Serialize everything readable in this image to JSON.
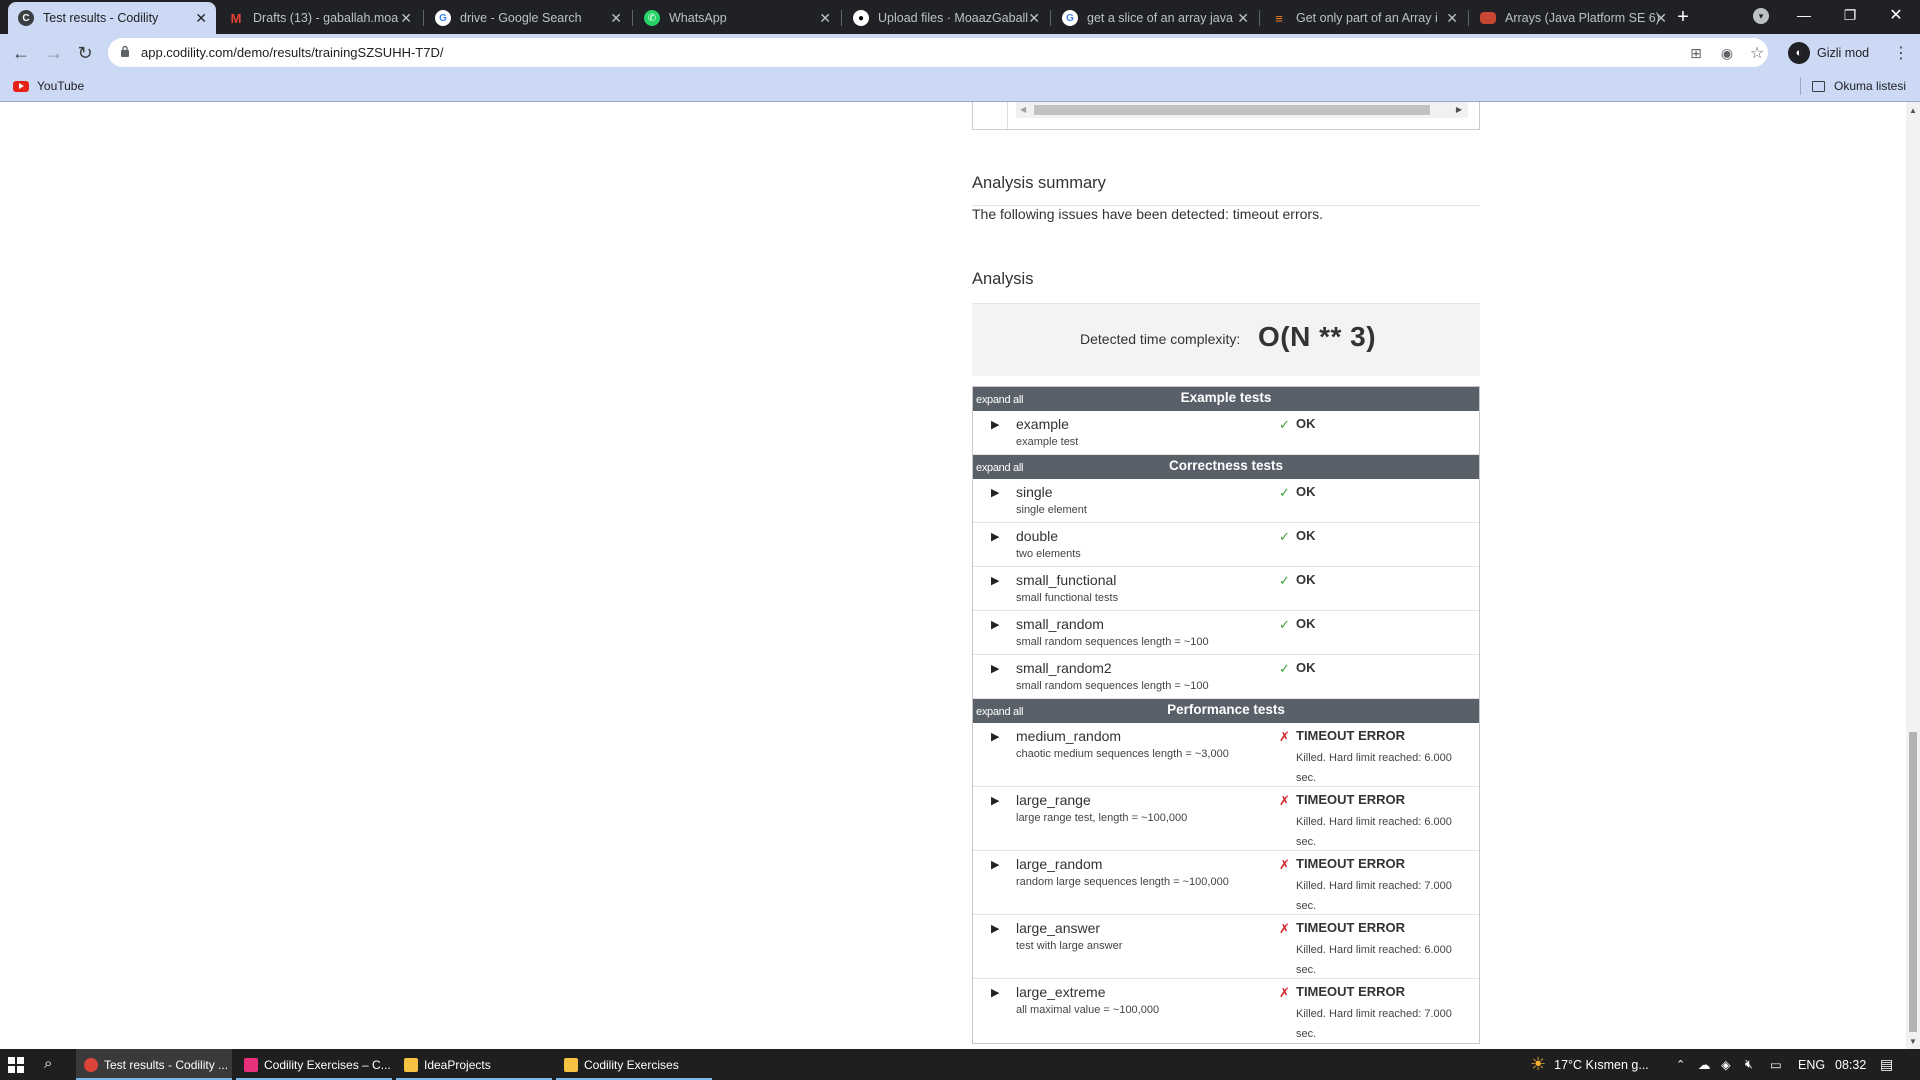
{
  "browser": {
    "tabs": [
      {
        "title": "Test results - Codility",
        "icon": "codility-icon",
        "active": true
      },
      {
        "title": "Drafts (13) - gaballah.moa",
        "icon": "gmail-icon"
      },
      {
        "title": "drive - Google Search",
        "icon": "google-icon"
      },
      {
        "title": "WhatsApp",
        "icon": "whatsapp-icon"
      },
      {
        "title": "Upload files · MoaazGaball",
        "icon": "github-icon"
      },
      {
        "title": "get a slice of an array java",
        "icon": "google-icon"
      },
      {
        "title": "Get only part of an Array i",
        "icon": "stackoverflow-icon"
      },
      {
        "title": "Arrays (Java Platform SE 6)",
        "icon": "oracle-icon"
      }
    ],
    "url": "app.codility.com/demo/results/trainingSZSUHH-T7D/",
    "profile_label": "Gizli mod",
    "bookmarks": {
      "youtube": "YouTube",
      "reading_list": "Okuma listesi"
    }
  },
  "page": {
    "summary_heading": "Analysis summary",
    "summary_text": "The following issues have been detected: timeout errors.",
    "analysis_heading": "Analysis",
    "complexity_label": "Detected time complexity:",
    "complexity_value": "O(N ** 3)",
    "expand_all": "expand all",
    "groups": [
      {
        "title": "Example tests",
        "tests": [
          {
            "name": "example",
            "desc": "example test",
            "mark": "✓",
            "status": "OK"
          }
        ]
      },
      {
        "title": "Correctness tests",
        "tests": [
          {
            "name": "single",
            "desc": "single element",
            "mark": "✓",
            "status": "OK"
          },
          {
            "name": "double",
            "desc": "two elements",
            "mark": "✓",
            "status": "OK"
          },
          {
            "name": "small_functional",
            "desc": "small functional tests",
            "mark": "✓",
            "status": "OK"
          },
          {
            "name": "small_random",
            "desc": "small random sequences length = ~100",
            "mark": "✓",
            "status": "OK"
          },
          {
            "name": "small_random2",
            "desc": "small random sequences length = ~100",
            "mark": "✓",
            "status": "OK"
          }
        ]
      },
      {
        "title": "Performance tests",
        "tests": [
          {
            "name": "medium_random",
            "desc": "chaotic medium sequences length = ~3,000",
            "mark": "✗",
            "status": "TIMEOUT ERROR",
            "detail": "Killed. Hard limit reached: 6.000 sec."
          },
          {
            "name": "large_range",
            "desc": "large range test, length = ~100,000",
            "mark": "✗",
            "status": "TIMEOUT ERROR",
            "detail": "Killed. Hard limit reached: 6.000 sec."
          },
          {
            "name": "large_random",
            "desc": "random large sequences length = ~100,000",
            "mark": "✗",
            "status": "TIMEOUT ERROR",
            "detail": "Killed. Hard limit reached: 7.000 sec."
          },
          {
            "name": "large_answer",
            "desc": "test with large answer",
            "mark": "✗",
            "status": "TIMEOUT ERROR",
            "detail": "Killed. Hard limit reached: 6.000 sec."
          },
          {
            "name": "large_extreme",
            "desc": "all maximal value = ~100,000",
            "mark": "✗",
            "status": "TIMEOUT ERROR",
            "detail": "Killed. Hard limit reached: 7.000 sec."
          }
        ]
      }
    ]
  },
  "taskbar": {
    "apps": [
      {
        "label": "Test results - Codility ...",
        "icon": "chrome-icon",
        "active": true
      },
      {
        "label": "Codility Exercises – C...",
        "icon": "intellij-icon"
      },
      {
        "label": "IdeaProjects",
        "icon": "folder-icon"
      },
      {
        "label": "Codility Exercises",
        "icon": "folder-icon"
      }
    ],
    "weather": "17°C  Kısmen g...",
    "lang": "ENG",
    "time": "08:32"
  },
  "colors": {
    "chrome_dark": "#202124",
    "toolbar": "#cbd9f5",
    "group_header": "#5a606a",
    "ok": "#3aa133",
    "error": "#d7242c"
  }
}
